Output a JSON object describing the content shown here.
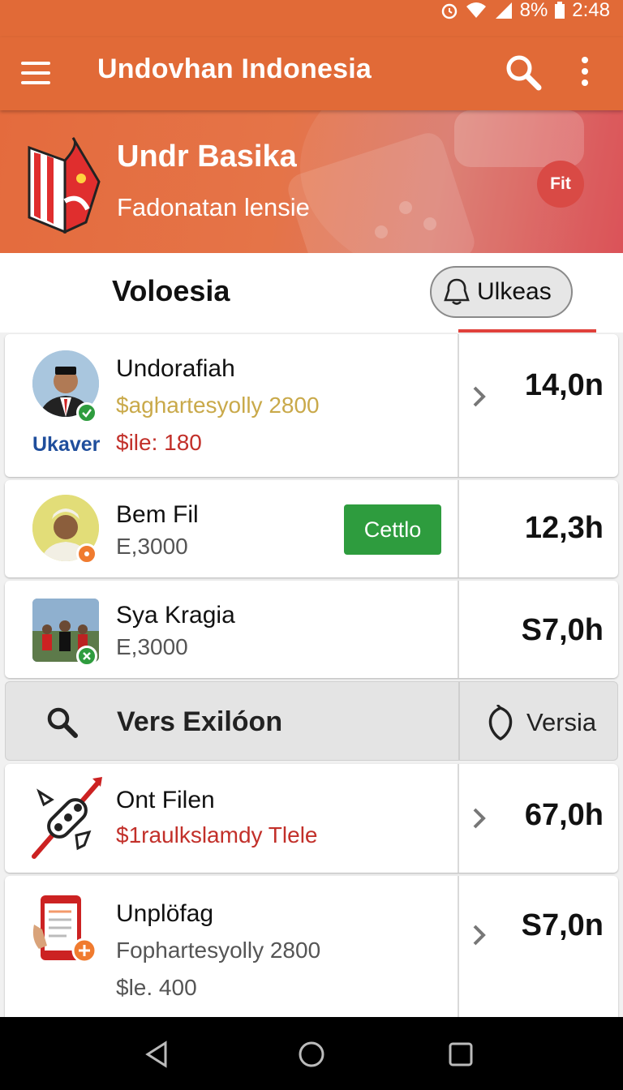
{
  "status_bar": {
    "battery": "8%",
    "time": "2:48"
  },
  "app_bar": {
    "title": "Undovhan Indonesia"
  },
  "banner": {
    "title": "Undr Basika",
    "subtitle": "Fadonatan lensie",
    "badge": "Fit"
  },
  "section": {
    "title": "Voloesia",
    "pill_label": "Ulkeas"
  },
  "rows": [
    {
      "name": "Undorafiah",
      "line2": "$aghartesyolly 2800",
      "line3": "$ile: 180",
      "tag": "Ukaver",
      "value": "14,0n",
      "line2_color": "#c9a94a",
      "line3_color": "#c2302a"
    },
    {
      "name": "Bem Fil",
      "line2": "E,3000",
      "button": "Cettlo",
      "value": "12,3h"
    },
    {
      "name": "Sya Kragia",
      "line2": "E,3000",
      "value": "S7,0h"
    },
    {
      "name": "Ont Filen",
      "line2": "$1raulkslamdy Tlele",
      "value": "67,0h",
      "line2_color": "#c2302a"
    },
    {
      "name": "Unplöfag",
      "line2": "Fophartesyolly 2800",
      "line3": "$le. 400",
      "value": "S7,0n"
    }
  ],
  "search_row": {
    "label": "Vers Exilóon",
    "right_label": "Versia"
  },
  "icons": {
    "menu": "menu-icon",
    "search": "search-icon",
    "more": "more-vert-icon",
    "back": "back-icon",
    "home": "home-icon",
    "recents": "recents-icon"
  },
  "colors": {
    "accent": "#e16a37",
    "green": "#2e9c3e",
    "red": "#e0413b"
  }
}
